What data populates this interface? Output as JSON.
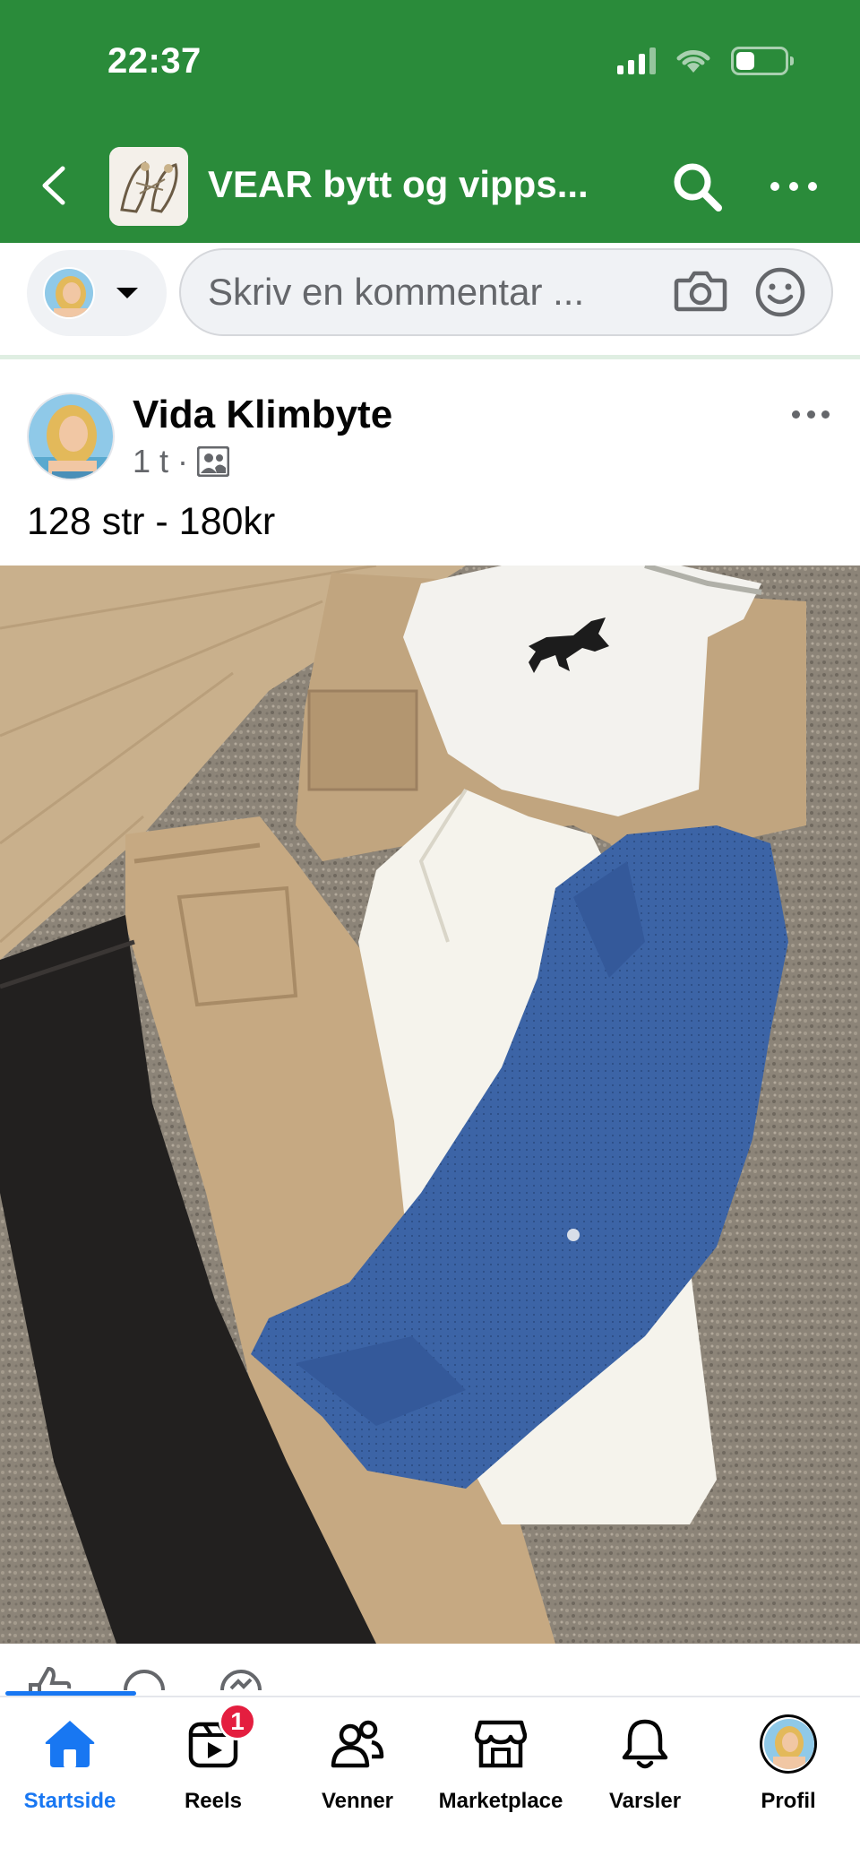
{
  "status_bar": {
    "time": "22:37"
  },
  "header": {
    "group_title": "VEAR bytt og vipps..."
  },
  "comment_bar": {
    "placeholder": "Skriv en kommentar ..."
  },
  "post": {
    "author": "Vida Klimbyte",
    "time_ago": "1 t",
    "separator": "·",
    "text": "128 str - 180kr"
  },
  "tabs": [
    {
      "label": "Startside",
      "icon": "home-icon",
      "active": true
    },
    {
      "label": "Reels",
      "icon": "reels-icon",
      "badge": "1"
    },
    {
      "label": "Venner",
      "icon": "friends-icon"
    },
    {
      "label": "Marketplace",
      "icon": "marketplace-icon"
    },
    {
      "label": "Varsler",
      "icon": "bell-icon"
    },
    {
      "label": "Profil",
      "icon": "profile-avatar"
    }
  ],
  "colors": {
    "header_green": "#2a8b3a",
    "accent_blue": "#1877f2",
    "badge_red": "#e41e3f"
  }
}
